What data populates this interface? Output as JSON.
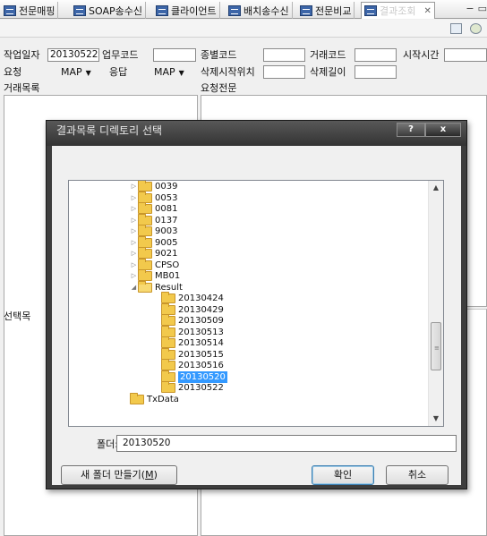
{
  "tabs": [
    {
      "label": "전문매핑",
      "active": false
    },
    {
      "label": "SOAP송수신",
      "active": false
    },
    {
      "label": "클라이언트",
      "active": false
    },
    {
      "label": "배치송수신",
      "active": false
    },
    {
      "label": "전문비교",
      "active": false
    },
    {
      "label": "결과조회",
      "active": true
    }
  ],
  "tab_close_glyph": "✕",
  "window_controls": {
    "minimize": "−",
    "restore": "▭"
  },
  "toolbar_icons": [
    "document-icon",
    "settings-icon"
  ],
  "form": {
    "work_date_label": "작업일자",
    "work_date_value": "20130522",
    "work_code_label": "업무코드",
    "work_code_value": "",
    "type_code_label": "종별코드",
    "type_code_value": "",
    "trans_code_label": "거래코드",
    "trans_code_value": "",
    "start_time_label": "시작시간",
    "start_time_value": "",
    "request_label": "요청",
    "request_value": "MAP",
    "response_label": "응답",
    "response_value": "MAP",
    "delete_start_label": "삭제시작위치",
    "delete_start_value": "",
    "delete_length_label": "삭제길이",
    "delete_length_value": "",
    "trade_list_label": "거래목록",
    "request_message_label": "요청전문",
    "select_label": "선택목"
  },
  "dialog": {
    "title": "결과목록 디렉토리 선택",
    "help_button": "?",
    "close_button": "x",
    "tree_items": [
      {
        "label": "0039",
        "level": 1,
        "expander": "▷",
        "open": false,
        "selected": false
      },
      {
        "label": "0053",
        "level": 1,
        "expander": "▷",
        "open": false,
        "selected": false
      },
      {
        "label": "0081",
        "level": 1,
        "expander": "▷",
        "open": false,
        "selected": false
      },
      {
        "label": "0137",
        "level": 1,
        "expander": "▷",
        "open": false,
        "selected": false
      },
      {
        "label": "9003",
        "level": 1,
        "expander": "▷",
        "open": false,
        "selected": false
      },
      {
        "label": "9005",
        "level": 1,
        "expander": "▷",
        "open": false,
        "selected": false
      },
      {
        "label": "9021",
        "level": 1,
        "expander": "▷",
        "open": false,
        "selected": false
      },
      {
        "label": "CPSO",
        "level": 1,
        "expander": "▷",
        "open": false,
        "selected": false
      },
      {
        "label": "MB01",
        "level": 1,
        "expander": "▷",
        "open": false,
        "selected": false
      },
      {
        "label": "Result",
        "level": 1,
        "expander": "◢",
        "open": true,
        "selected": false
      },
      {
        "label": "20130424",
        "level": 2,
        "expander": "",
        "open": false,
        "selected": false
      },
      {
        "label": "20130429",
        "level": 2,
        "expander": "",
        "open": false,
        "selected": false
      },
      {
        "label": "20130509",
        "level": 2,
        "expander": "",
        "open": false,
        "selected": false
      },
      {
        "label": "20130513",
        "level": 2,
        "expander": "",
        "open": false,
        "selected": false
      },
      {
        "label": "20130514",
        "level": 2,
        "expander": "",
        "open": false,
        "selected": false
      },
      {
        "label": "20130515",
        "level": 2,
        "expander": "",
        "open": false,
        "selected": false
      },
      {
        "label": "20130516",
        "level": 2,
        "expander": "",
        "open": false,
        "selected": false
      },
      {
        "label": "20130520",
        "level": 2,
        "expander": "",
        "open": false,
        "selected": true
      },
      {
        "label": "20130522",
        "level": 2,
        "expander": "",
        "open": false,
        "selected": false
      },
      {
        "label": "TxData",
        "level": 0,
        "expander": "",
        "open": false,
        "selected": false
      }
    ],
    "folder_label": "폴더:",
    "folder_value": "20130520",
    "new_folder_button": "새 폴더 만들기(",
    "new_folder_mnemonic": "M",
    "new_folder_suffix": ")",
    "ok_button": "확인",
    "cancel_button": "취소",
    "scroll_up": "▲",
    "scroll_down": "▼",
    "scroll_grip": "≡"
  },
  "colors": {
    "tab_icon": "#3d66a8",
    "selection": "#3399ff",
    "folder": "#f2c94c",
    "dialog_frame": "#3d3d3d"
  }
}
